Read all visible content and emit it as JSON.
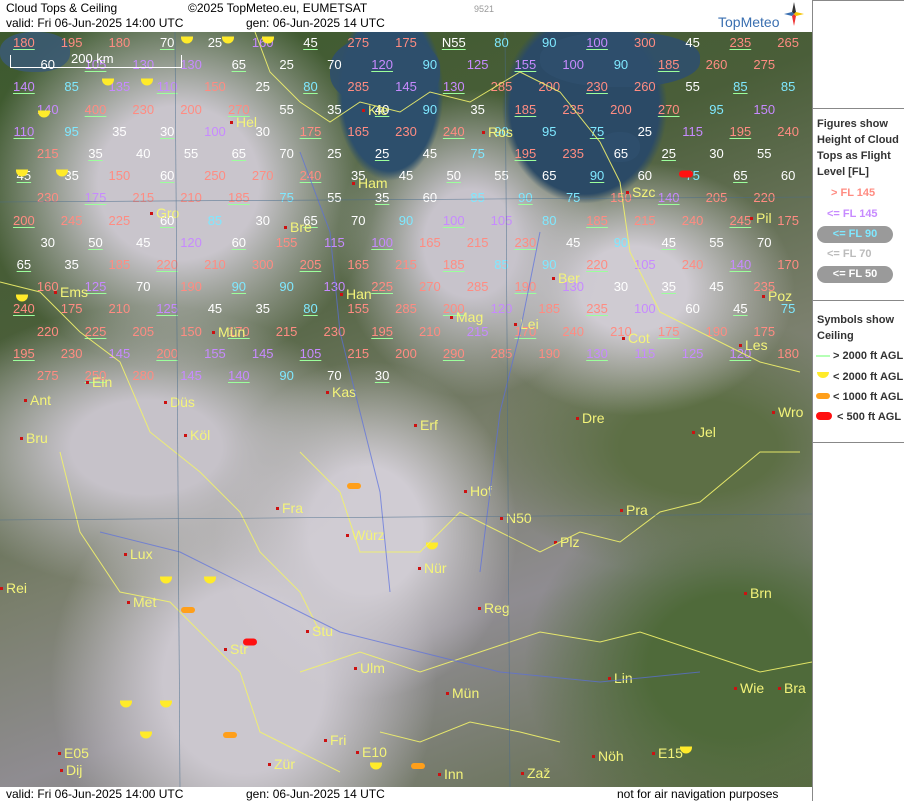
{
  "header": {
    "title": "Cloud Tops & Ceiling",
    "copyright": "©2025 TopMeteo.eu, EUMETSAT",
    "valid": "valid:  Fri  06-Jun-2025  14:00 UTC",
    "gen": "gen: 06-Jun-2025 14 UTC",
    "id": "9521",
    "brand": "TopMeteo"
  },
  "footer": {
    "valid": "valid:  Fri  06-Jun-2025  14:00 UTC",
    "gen": "gen: 06-Jun-2025 14 UTC",
    "note": "not for air navigation purposes"
  },
  "scale": {
    "label": "200 km"
  },
  "legend": {
    "heading": [
      "Figures show",
      "Height of Cloud",
      "Tops as Flight",
      "Level  [FL]"
    ],
    "items": [
      {
        "text": "> FL 145",
        "color": "#ff8c82"
      },
      {
        "text": "<= FL 145",
        "color": "#c78aff"
      },
      {
        "text": "<= FL 90",
        "color": "#7fe8ff"
      },
      {
        "text": "<= FL 70",
        "color": "#ffffff"
      },
      {
        "text": "<= FL 50",
        "color": "#ffffff"
      }
    ],
    "sym_heading": [
      "Symbols show",
      "Ceiling"
    ],
    "sym_items": [
      {
        "text": "> 2000 ft AGL",
        "color": "#9cff9c"
      },
      {
        "text": "< 2000 ft AGL",
        "color": "#ffeb2a"
      },
      {
        "text": "< 1000 ft AGL",
        "color": "#ff9f1a"
      },
      {
        "text": "< 500 ft AGL",
        "color": "#ff1010"
      }
    ]
  },
  "cities": [
    "Hel",
    "Kie",
    "Ros",
    "Ham",
    "Szc",
    "Gro",
    "Bre",
    "Pil",
    "Ber",
    "Ems",
    "Han",
    "Mag",
    "Poz",
    "Lei",
    "Cot",
    "Les",
    "Mün",
    "Kas",
    "Ein",
    "Dre",
    "Wro",
    "Düs",
    "Ant",
    "Bru",
    "Köl",
    "Erf",
    "Jel",
    "Hof",
    "Fra",
    "N50",
    "Lux",
    "Würz",
    "Pra",
    "Plz",
    "Rei",
    "Met",
    "Nür",
    "Reg",
    "Brn",
    "Stu",
    "Str",
    "Ulm",
    "Lin",
    "Wie",
    "Bra",
    "Mün",
    "Fri",
    "Zür",
    "E10",
    "E05",
    "E15",
    "Dij",
    "Inn",
    "Zaž",
    "Nöh"
  ],
  "cloud_tops": [
    {
      "v": "180",
      "c": "g"
    },
    {
      "v": "195",
      "c": "g"
    },
    {
      "v": "180",
      "c": "g"
    },
    {
      "v": "70",
      "c": "w"
    },
    {
      "v": "25",
      "c": "w"
    },
    {
      "v": "160",
      "c": "p"
    },
    {
      "v": "45",
      "c": "w"
    },
    {
      "v": "275",
      "c": "g"
    },
    {
      "v": "175",
      "c": "g"
    },
    {
      "v": "N55",
      "c": "w"
    },
    {
      "v": "80",
      "c": "c"
    },
    {
      "v": "90",
      "c": "c"
    },
    {
      "v": "100",
      "c": "p"
    },
    {
      "v": "300",
      "c": "g"
    },
    {
      "v": "45",
      "c": "w"
    },
    {
      "v": "235",
      "c": "g"
    },
    {
      "v": "265",
      "c": "g"
    },
    {
      "v": "60",
      "c": "w"
    },
    {
      "v": "105",
      "c": "p"
    },
    {
      "v": "130",
      "c": "p"
    },
    {
      "v": "130",
      "c": "p"
    },
    {
      "v": "65",
      "c": "w"
    },
    {
      "v": "25",
      "c": "w"
    },
    {
      "v": "70",
      "c": "w"
    },
    {
      "v": "120",
      "c": "p"
    },
    {
      "v": "90",
      "c": "c"
    },
    {
      "v": "125",
      "c": "p"
    },
    {
      "v": "155",
      "c": "p"
    },
    {
      "v": "100",
      "c": "p"
    },
    {
      "v": "90",
      "c": "c"
    },
    {
      "v": "185",
      "c": "g"
    },
    {
      "v": "260",
      "c": "g"
    },
    {
      "v": "275",
      "c": "g"
    },
    {
      "v": "140",
      "c": "p"
    },
    {
      "v": "85",
      "c": "c"
    },
    {
      "v": "135",
      "c": "p"
    },
    {
      "v": "110",
      "c": "p"
    },
    {
      "v": "150",
      "c": "g"
    },
    {
      "v": "25",
      "c": "w"
    },
    {
      "v": "80",
      "c": "c"
    },
    {
      "v": "285",
      "c": "g"
    },
    {
      "v": "145",
      "c": "p"
    },
    {
      "v": "130",
      "c": "p"
    },
    {
      "v": "285",
      "c": "g"
    },
    {
      "v": "200",
      "c": "g"
    },
    {
      "v": "230",
      "c": "g"
    },
    {
      "v": "260",
      "c": "g"
    },
    {
      "v": "55",
      "c": "w"
    },
    {
      "v": "85",
      "c": "c"
    },
    {
      "v": "85",
      "c": "c"
    },
    {
      "v": "140",
      "c": "p"
    },
    {
      "v": "400",
      "c": "g"
    },
    {
      "v": "230",
      "c": "g"
    },
    {
      "v": "200",
      "c": "g"
    },
    {
      "v": "270",
      "c": "g"
    },
    {
      "v": "55",
      "c": "w"
    },
    {
      "v": "35",
      "c": "w"
    },
    {
      "v": "40",
      "c": "w"
    },
    {
      "v": "90",
      "c": "c"
    },
    {
      "v": "35",
      "c": "w"
    },
    {
      "v": "185",
      "c": "g"
    },
    {
      "v": "235",
      "c": "g"
    },
    {
      "v": "200",
      "c": "g"
    },
    {
      "v": "270",
      "c": "g"
    },
    {
      "v": "95",
      "c": "c"
    },
    {
      "v": "150",
      "c": "p"
    },
    {
      "v": "110",
      "c": "p"
    },
    {
      "v": "95",
      "c": "c"
    },
    {
      "v": "35",
      "c": "w"
    },
    {
      "v": "30",
      "c": "w"
    },
    {
      "v": "100",
      "c": "p"
    },
    {
      "v": "30",
      "c": "w"
    },
    {
      "v": "175",
      "c": "g"
    },
    {
      "v": "165",
      "c": "g"
    },
    {
      "v": "230",
      "c": "g"
    },
    {
      "v": "240",
      "c": "g"
    },
    {
      "v": "90",
      "c": "c"
    },
    {
      "v": "95",
      "c": "c"
    },
    {
      "v": "75",
      "c": "c"
    },
    {
      "v": "25",
      "c": "w"
    },
    {
      "v": "115",
      "c": "p"
    },
    {
      "v": "195",
      "c": "g"
    },
    {
      "v": "240",
      "c": "g"
    },
    {
      "v": "215",
      "c": "g"
    },
    {
      "v": "35",
      "c": "w"
    },
    {
      "v": "40",
      "c": "w"
    },
    {
      "v": "55",
      "c": "w"
    },
    {
      "v": "65",
      "c": "w"
    },
    {
      "v": "70",
      "c": "w"
    },
    {
      "v": "25",
      "c": "w"
    },
    {
      "v": "25",
      "c": "w"
    },
    {
      "v": "45",
      "c": "w"
    },
    {
      "v": "75",
      "c": "c"
    },
    {
      "v": "195",
      "c": "g"
    },
    {
      "v": "235",
      "c": "g"
    },
    {
      "v": "65",
      "c": "w"
    },
    {
      "v": "25",
      "c": "w"
    },
    {
      "v": "30",
      "c": "w"
    },
    {
      "v": "55",
      "c": "w"
    },
    {
      "v": "45",
      "c": "w"
    },
    {
      "v": "35",
      "c": "w"
    },
    {
      "v": "150",
      "c": "g"
    },
    {
      "v": "60",
      "c": "w"
    },
    {
      "v": "250",
      "c": "g"
    },
    {
      "v": "270",
      "c": "g"
    },
    {
      "v": "240",
      "c": "g"
    },
    {
      "v": "35",
      "c": "w"
    },
    {
      "v": "45",
      "c": "w"
    },
    {
      "v": "50",
      "c": "w"
    },
    {
      "v": "55",
      "c": "w"
    },
    {
      "v": "65",
      "c": "w"
    },
    {
      "v": "90",
      "c": "c"
    },
    {
      "v": "60",
      "c": "w"
    },
    {
      "v": "75",
      "c": "c"
    },
    {
      "v": "65",
      "c": "w"
    },
    {
      "v": "60",
      "c": "w"
    },
    {
      "v": "230",
      "c": "g"
    },
    {
      "v": "175",
      "c": "p"
    },
    {
      "v": "215",
      "c": "g"
    },
    {
      "v": "210",
      "c": "g"
    },
    {
      "v": "185",
      "c": "g"
    },
    {
      "v": "75",
      "c": "c"
    },
    {
      "v": "55",
      "c": "w"
    },
    {
      "v": "35",
      "c": "w"
    },
    {
      "v": "60",
      "c": "w"
    },
    {
      "v": "85",
      "c": "c"
    },
    {
      "v": "90",
      "c": "c"
    },
    {
      "v": "75",
      "c": "c"
    },
    {
      "v": "150",
      "c": "g"
    },
    {
      "v": "140",
      "c": "p"
    },
    {
      "v": "205",
      "c": "g"
    },
    {
      "v": "220",
      "c": "g"
    },
    {
      "v": "200",
      "c": "g"
    },
    {
      "v": "245",
      "c": "g"
    },
    {
      "v": "225",
      "c": "g"
    },
    {
      "v": "60",
      "c": "w"
    },
    {
      "v": "85",
      "c": "c"
    },
    {
      "v": "30",
      "c": "w"
    },
    {
      "v": "65",
      "c": "w"
    },
    {
      "v": "70",
      "c": "w"
    },
    {
      "v": "90",
      "c": "c"
    },
    {
      "v": "100",
      "c": "p"
    },
    {
      "v": "105",
      "c": "p"
    },
    {
      "v": "80",
      "c": "c"
    },
    {
      "v": "185",
      "c": "g"
    },
    {
      "v": "215",
      "c": "g"
    },
    {
      "v": "240",
      "c": "g"
    },
    {
      "v": "245",
      "c": "g"
    },
    {
      "v": "175",
      "c": "g"
    },
    {
      "v": "30",
      "c": "w"
    },
    {
      "v": "50",
      "c": "w"
    },
    {
      "v": "45",
      "c": "w"
    },
    {
      "v": "120",
      "c": "p"
    },
    {
      "v": "60",
      "c": "w"
    },
    {
      "v": "155",
      "c": "g"
    },
    {
      "v": "115",
      "c": "p"
    },
    {
      "v": "100",
      "c": "p"
    },
    {
      "v": "165",
      "c": "g"
    },
    {
      "v": "215",
      "c": "g"
    },
    {
      "v": "230",
      "c": "g"
    },
    {
      "v": "45",
      "c": "w"
    },
    {
      "v": "90",
      "c": "c"
    },
    {
      "v": "45",
      "c": "w"
    },
    {
      "v": "55",
      "c": "w"
    },
    {
      "v": "70",
      "c": "w"
    },
    {
      "v": "65",
      "c": "w"
    },
    {
      "v": "35",
      "c": "w"
    },
    {
      "v": "185",
      "c": "g"
    },
    {
      "v": "220",
      "c": "g"
    },
    {
      "v": "210",
      "c": "g"
    },
    {
      "v": "300",
      "c": "g"
    },
    {
      "v": "205",
      "c": "g"
    },
    {
      "v": "165",
      "c": "g"
    },
    {
      "v": "215",
      "c": "g"
    },
    {
      "v": "185",
      "c": "g"
    },
    {
      "v": "85",
      "c": "c"
    },
    {
      "v": "90",
      "c": "c"
    },
    {
      "v": "220",
      "c": "g"
    },
    {
      "v": "105",
      "c": "p"
    },
    {
      "v": "240",
      "c": "g"
    },
    {
      "v": "140",
      "c": "p"
    },
    {
      "v": "170",
      "c": "g"
    },
    {
      "v": "160",
      "c": "g"
    },
    {
      "v": "125",
      "c": "p"
    },
    {
      "v": "70",
      "c": "w"
    },
    {
      "v": "190",
      "c": "g"
    },
    {
      "v": "90",
      "c": "c"
    },
    {
      "v": "90",
      "c": "c"
    },
    {
      "v": "130",
      "c": "p"
    },
    {
      "v": "225",
      "c": "g"
    },
    {
      "v": "270",
      "c": "g"
    },
    {
      "v": "285",
      "c": "g"
    },
    {
      "v": "190",
      "c": "g"
    },
    {
      "v": "130",
      "c": "p"
    },
    {
      "v": "30",
      "c": "w"
    },
    {
      "v": "35",
      "c": "w"
    },
    {
      "v": "45",
      "c": "w"
    },
    {
      "v": "235",
      "c": "g"
    },
    {
      "v": "240",
      "c": "g"
    },
    {
      "v": "175",
      "c": "g"
    },
    {
      "v": "210",
      "c": "g"
    },
    {
      "v": "125",
      "c": "p"
    },
    {
      "v": "45",
      "c": "w"
    },
    {
      "v": "35",
      "c": "w"
    },
    {
      "v": "80",
      "c": "c"
    },
    {
      "v": "155",
      "c": "g"
    },
    {
      "v": "285",
      "c": "g"
    },
    {
      "v": "200",
      "c": "g"
    },
    {
      "v": "120",
      "c": "p"
    },
    {
      "v": "185",
      "c": "g"
    },
    {
      "v": "235",
      "c": "g"
    },
    {
      "v": "100",
      "c": "p"
    },
    {
      "v": "60",
      "c": "w"
    },
    {
      "v": "45",
      "c": "w"
    },
    {
      "v": "75",
      "c": "c"
    },
    {
      "v": "220",
      "c": "g"
    },
    {
      "v": "225",
      "c": "g"
    },
    {
      "v": "205",
      "c": "g"
    },
    {
      "v": "150",
      "c": "g"
    },
    {
      "v": "170",
      "c": "g"
    },
    {
      "v": "215",
      "c": "g"
    },
    {
      "v": "230",
      "c": "g"
    },
    {
      "v": "195",
      "c": "g"
    },
    {
      "v": "210",
      "c": "g"
    },
    {
      "v": "215",
      "c": "p"
    },
    {
      "v": "170",
      "c": "g"
    },
    {
      "v": "240",
      "c": "g"
    },
    {
      "v": "210",
      "c": "g"
    },
    {
      "v": "175",
      "c": "g"
    },
    {
      "v": "190",
      "c": "g"
    },
    {
      "v": "175",
      "c": "g"
    },
    {
      "v": "195",
      "c": "g"
    },
    {
      "v": "230",
      "c": "g"
    },
    {
      "v": "145",
      "c": "p"
    },
    {
      "v": "200",
      "c": "g"
    },
    {
      "v": "155",
      "c": "p"
    },
    {
      "v": "145",
      "c": "p"
    },
    {
      "v": "105",
      "c": "p"
    },
    {
      "v": "215",
      "c": "g"
    },
    {
      "v": "200",
      "c": "g"
    },
    {
      "v": "290",
      "c": "g"
    },
    {
      "v": "285",
      "c": "g"
    },
    {
      "v": "190",
      "c": "g"
    },
    {
      "v": "130",
      "c": "p"
    },
    {
      "v": "115",
      "c": "p"
    },
    {
      "v": "125",
      "c": "p"
    },
    {
      "v": "120",
      "c": "p"
    },
    {
      "v": "180",
      "c": "g"
    },
    {
      "v": "275",
      "c": "g"
    },
    {
      "v": "250",
      "c": "g"
    },
    {
      "v": "280",
      "c": "g"
    },
    {
      "v": "145",
      "c": "p"
    },
    {
      "v": "140",
      "c": "p"
    },
    {
      "v": "90",
      "c": "c"
    },
    {
      "v": "70",
      "c": "w"
    },
    {
      "v": "30",
      "c": "w"
    }
  ]
}
